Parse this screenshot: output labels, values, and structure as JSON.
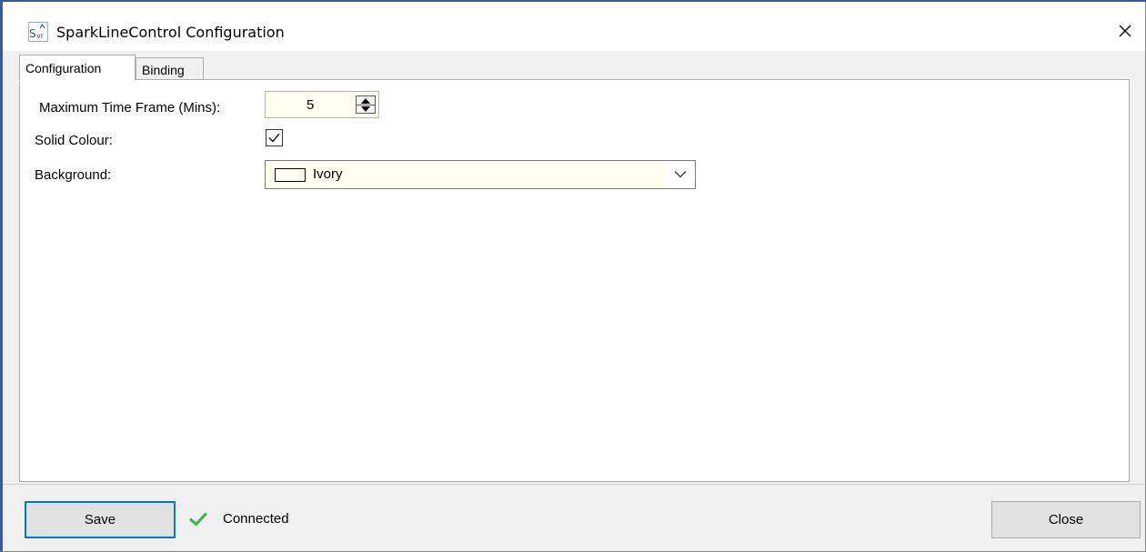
{
  "window": {
    "title": "SparkLineControl Configuration",
    "icon": "svr-app-icon",
    "close_icon": "close-icon"
  },
  "tabs": [
    {
      "label": "Configuration",
      "active": true
    },
    {
      "label": "Binding",
      "active": false
    }
  ],
  "form": {
    "time_frame": {
      "label": "Maximum Time Frame (Mins):",
      "value": "5"
    },
    "solid_colour": {
      "label": "Solid Colour:",
      "checked": true
    },
    "background": {
      "label": "Background:",
      "value": "Ivory",
      "swatch_color": "#FFFFF0"
    }
  },
  "footer": {
    "save_label": "Save",
    "status_text": "Connected",
    "status_icon": "check-icon",
    "status_color": "#4caf50",
    "close_label": "Close"
  }
}
